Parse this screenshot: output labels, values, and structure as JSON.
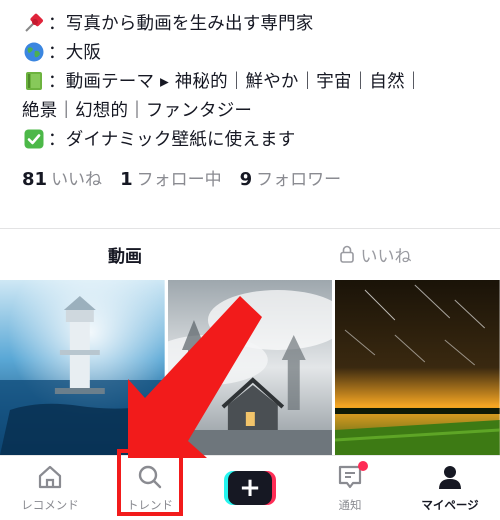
{
  "bio": {
    "lines": [
      {
        "icon": "pushpin-icon",
        "text": "：写真から動画を生み出す専門家"
      },
      {
        "icon": "globe-icon",
        "text": "：大阪"
      },
      {
        "icon": "green-book-icon",
        "text": "：動画テーマ ▸ 神秘的｜鮮やか｜宇宙｜自然｜"
      },
      {
        "icon": "",
        "text": "絶景｜幻想的｜ファンタジー"
      },
      {
        "icon": "check-mark-button-icon",
        "text": "：ダイナミック壁紙に使えます"
      }
    ]
  },
  "stats": {
    "likes_count": "81",
    "likes_label": "いいね",
    "following_count": "1",
    "following_label": "フォロー中",
    "followers_count": "9",
    "followers_label": "フォロワー"
  },
  "tabs": {
    "videos_label": "動画",
    "likes_label": "いいね"
  },
  "videos": [
    {
      "icon": "lighthouse-ocean-thumbnail"
    },
    {
      "icon": "misty-cabin-thumbnail"
    },
    {
      "icon": "meteor-field-thumbnail"
    }
  ],
  "nav": {
    "recommend_label": "レコメンド",
    "trend_label": "トレンド",
    "create_label": "+",
    "inbox_label": "通知",
    "profile_label": "マイページ"
  },
  "colors": {
    "accent_red": "#fe2c55",
    "accent_cyan": "#25f4ee",
    "annotation_red": "#f21b1b",
    "text_primary": "#161823",
    "text_secondary": "#8a8b91"
  }
}
